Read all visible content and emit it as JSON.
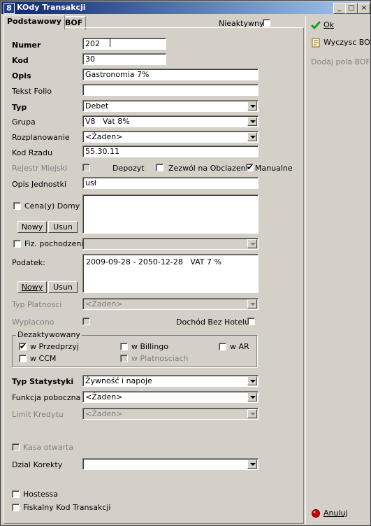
{
  "window": {
    "title": "KOdy Transakcji",
    "min_btn": "_",
    "max_btn": "□",
    "close_btn": "×"
  },
  "tabs": [
    {
      "label": "Podstawowy"
    },
    {
      "label": "BOF"
    }
  ],
  "inactive": {
    "label": "Nieaktywny"
  },
  "fields": {
    "numer": {
      "label": "Numer",
      "value": "202"
    },
    "kod": {
      "label": "Kod",
      "value": "30"
    },
    "opis": {
      "label": "Opis",
      "value": "Gastronomia 7%"
    },
    "tekst_folio": {
      "label": "Tekst Folio",
      "value": ""
    },
    "typ": {
      "label": "Typ",
      "value": "Debet"
    },
    "grupa": {
      "label": "Grupa",
      "value": "V8   Vat 8%"
    },
    "rozplanowanie": {
      "label": "Rozplanowanie",
      "value": "<Żaden>"
    },
    "kod_rzadu": {
      "label": "Kod Rzadu",
      "value": "55.30.11"
    },
    "rejestr_miejski": {
      "label": "Rejestr Miejski"
    },
    "depozyt": {
      "label": "Depozyt"
    },
    "zezwol": {
      "label": "Zezwól na Obciazenie Manualne"
    },
    "opis_jednostki": {
      "label": "Opis Jednostki",
      "value": "usł"
    },
    "ceny_domyslne": {
      "label": "Cena(y) Domyslne"
    },
    "nowy1": {
      "label": "Nowy"
    },
    "usun1": {
      "label": "Usun"
    },
    "fiz_pochodzenie": {
      "label": "Fiz. pochodzenie",
      "value": ""
    },
    "podatek": {
      "label": "Podatek:",
      "value": "2009-09-28 - 2050-12-28   VAT 7 %"
    },
    "nowy2": {
      "label": "Nowy"
    },
    "usun2": {
      "label": "Usun"
    },
    "typ_platnosci": {
      "label": "Typ Platnosci",
      "value": "<Żaden>"
    },
    "wyplacono": {
      "label": "Wyplacono"
    },
    "dochod": {
      "label": "Dochód Bez Hotelu"
    },
    "dezaktywowany": {
      "label": "Dezaktywowany",
      "w_przedprzyj": "w Przedprzyj",
      "w_billingo": "w Billingo",
      "w_ar": "w AR",
      "w_ccm": "w CCM",
      "w_platnosciach": "w Platnosciach"
    },
    "typ_statystyki": {
      "label": "Typ Statystyki",
      "value": "Żywność i napoje"
    },
    "funkcja_poboczna": {
      "label": "Funkcja poboczna Fo",
      "value": "<Żaden>"
    },
    "limit_kredytu": {
      "label": "Limit Kredytu",
      "value": "<Żaden>"
    },
    "kasa_otwarta": {
      "label": "Kasa otwarta"
    },
    "dzial_korekty": {
      "label": "Dzial Korekty",
      "value": ""
    },
    "hostessa": {
      "label": "Hostessa"
    },
    "fiskalny": {
      "label": "Fiskalny Kod Transakcji"
    }
  },
  "side": {
    "ok": "Ok",
    "wyczysc": "Wyczysc BOF",
    "dodaj": "Dodaj pola BOF",
    "anuluj": "Anuluj"
  },
  "check": "✔",
  "colors": {
    "titlebar": "#0a246a",
    "face": "#d4d0c8",
    "ok_icon": "#1aa01a",
    "cancel_icon": "#d00000"
  }
}
